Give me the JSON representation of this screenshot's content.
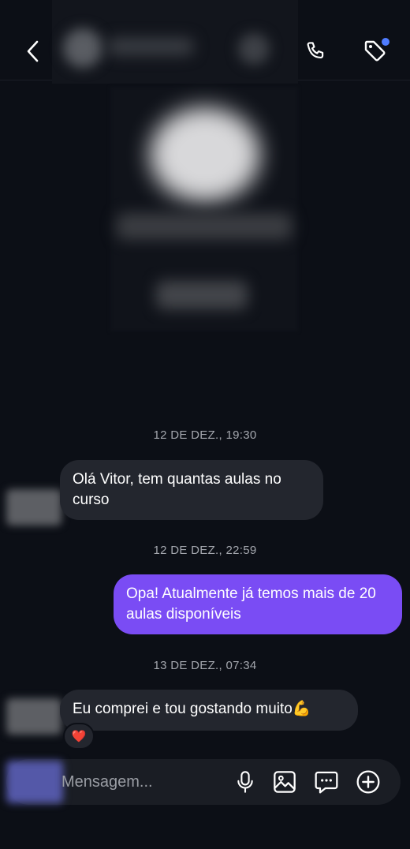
{
  "header": {
    "back_icon": "chevron-left-icon",
    "call_icon": "phone-icon",
    "tag_icon": "tag-icon",
    "tag_badge_color": "#4f7cff"
  },
  "messages": [
    {
      "timestamp": "12 DE DEZ., 19:30"
    },
    {
      "direction": "incoming",
      "text": "Olá Vitor, tem quantas aulas no curso"
    },
    {
      "timestamp": "12 DE DEZ., 22:59"
    },
    {
      "direction": "outgoing",
      "text": "Opa! Atualmente já temos mais de 20 aulas disponíveis"
    },
    {
      "timestamp": "13 DE DEZ., 07:34"
    },
    {
      "direction": "incoming",
      "text": "Eu comprei e tou gostando muito💪",
      "reaction": "❤️"
    }
  ],
  "composer": {
    "placeholder": "Mensagem...",
    "icons": [
      "microphone-icon",
      "image-icon",
      "chat-icon",
      "add-icon"
    ]
  },
  "colors": {
    "background": "#0c0f16",
    "incoming_bubble": "#23262e",
    "outgoing_bubble": "#7a4cf4",
    "timestamp_text": "#a4a7ae"
  }
}
